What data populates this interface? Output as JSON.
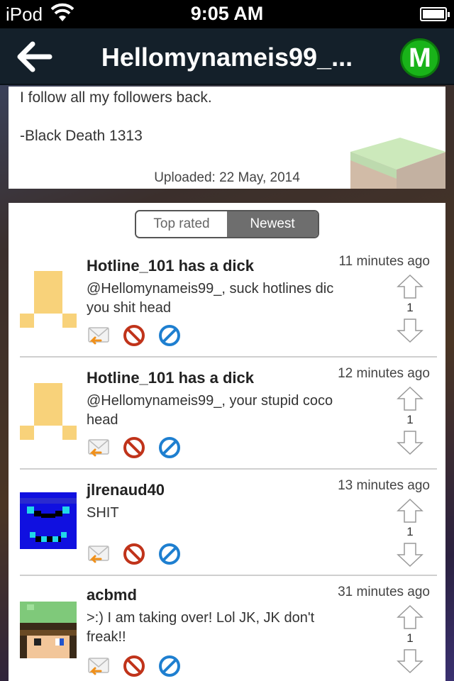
{
  "status_bar": {
    "carrier": "iPod",
    "time": "9:05 AM",
    "wifi_icon": "wifi-icon",
    "battery_icon": "battery-full-icon"
  },
  "nav": {
    "title": "Hellomynameis99_...",
    "back_icon": "back-arrow-icon",
    "logo_letter": "M",
    "logo_color": "#19b319"
  },
  "description": {
    "line1": "I follow all my followers back.",
    "line2": "-Black Death 1313",
    "uploaded": "Uploaded: 22 May, 2014"
  },
  "sort": {
    "options": [
      "Top rated",
      "Newest"
    ],
    "selected": "Newest"
  },
  "comments": [
    {
      "author": "Hotline_101 has a dick",
      "time": "11 minutes ago",
      "text_line1": "@Hellomynameis99_, suck hotlines dic",
      "text_line2": "you shit head",
      "votes": "1",
      "avatar": "yellow-skin-avatar"
    },
    {
      "author": "Hotline_101 has a dick",
      "time": "12 minutes ago",
      "text_line1": "@Hellomynameis99_, your stupid coco",
      "text_line2": "head",
      "votes": "1",
      "avatar": "yellow-skin-avatar"
    },
    {
      "author": "jlrenaud40",
      "time": "13 minutes ago",
      "text_line1": "SHIT",
      "text_line2": "",
      "votes": "1",
      "avatar": "blue-skin-avatar"
    },
    {
      "author": "acbmd",
      "time": "31 minutes ago",
      "text_line1": ">:) I am taking over! Lol JK, JK don't",
      "text_line2": "freak!!",
      "votes": "1",
      "avatar": "green-hat-skin-avatar"
    }
  ],
  "colors": {
    "nav_bg": "#14202a",
    "segment_active": "#6e6e6e",
    "block_icon": "#c0331a",
    "ignore_icon": "#1e7fd0",
    "reply_icon": "#f0901a"
  }
}
